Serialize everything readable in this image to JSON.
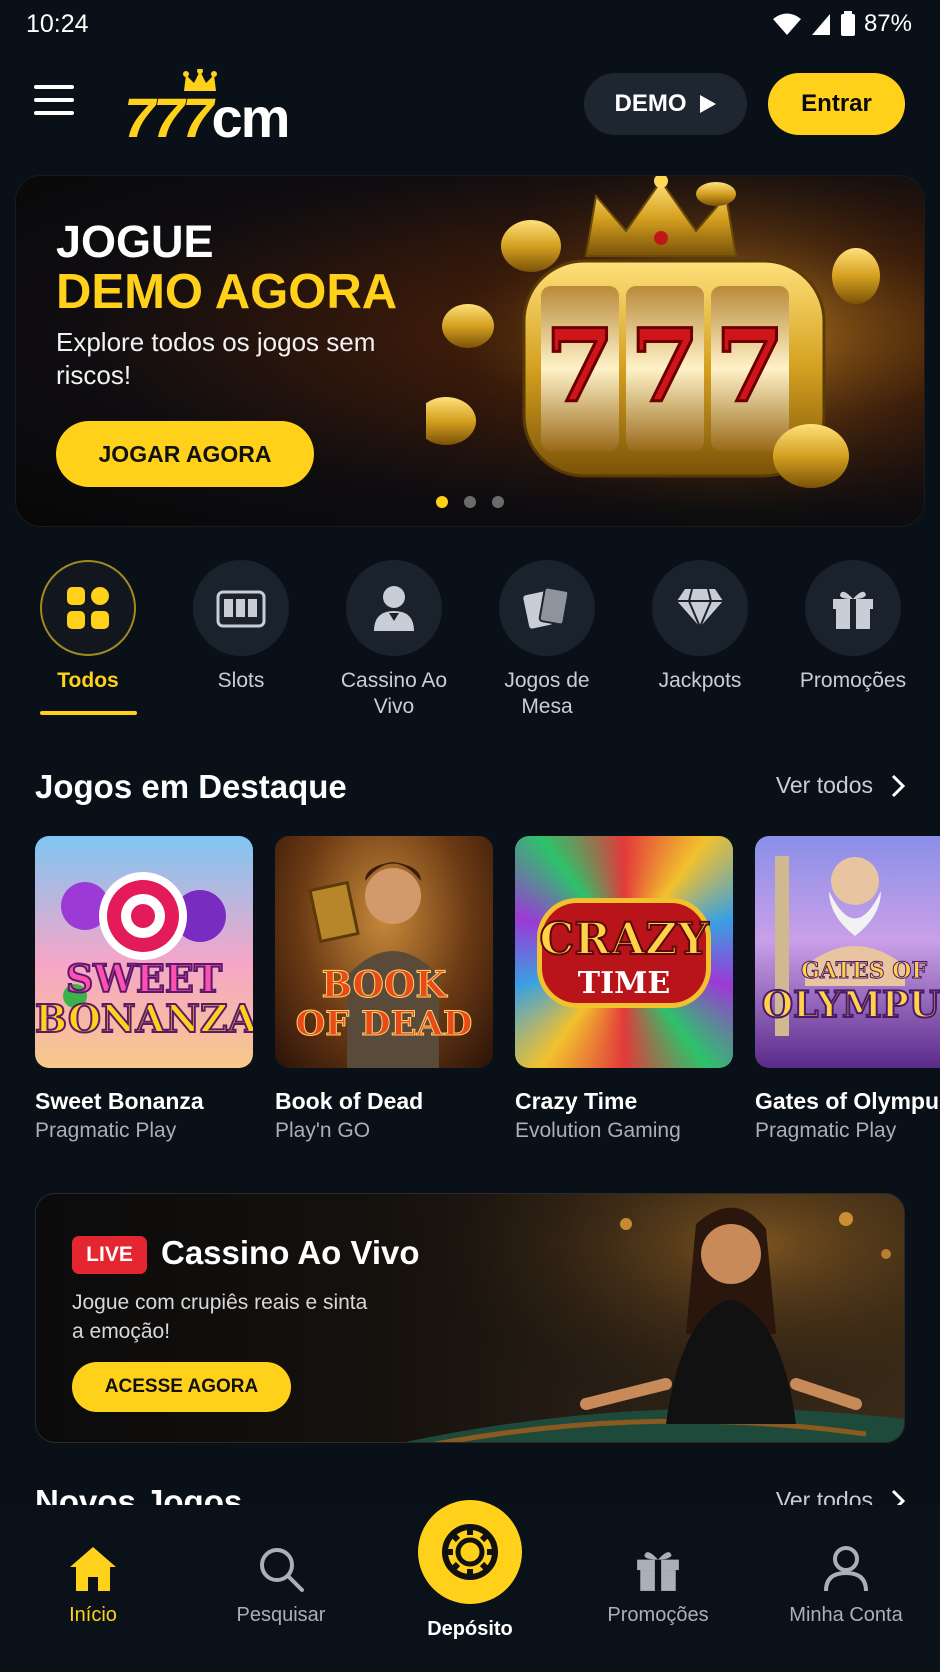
{
  "status": {
    "time": "10:24",
    "battery": "87%"
  },
  "header": {
    "logo_number": "777",
    "logo_suffix": "cm",
    "demo_label": "DEMO",
    "login_label": "Entrar"
  },
  "hero": {
    "title_line1": "JOGUE",
    "title_line2": "DEMO AGORA",
    "subtitle": "Explore todos os jogos sem riscos!",
    "cta": "JOGAR AGORA",
    "slot_digits": "777",
    "slides": 3,
    "active_slide": 1
  },
  "categories": [
    {
      "label": "Todos",
      "icon": "grid-icon",
      "active": true
    },
    {
      "label": "Slots",
      "icon": "slot-machine-icon"
    },
    {
      "label": "Cassino Ao Vivo",
      "icon": "dealer-icon"
    },
    {
      "label": "Jogos de Mesa",
      "icon": "cards-icon"
    },
    {
      "label": "Jackpots",
      "icon": "diamond-icon"
    },
    {
      "label": "Promoções",
      "icon": "gift-icon"
    }
  ],
  "featured": {
    "title": "Jogos em Destaque",
    "see_all": "Ver todos",
    "games": [
      {
        "name": "Sweet Bonanza",
        "provider": "Pragmatic Play",
        "art_line1": "SWEET",
        "art_line2": "BONANZA"
      },
      {
        "name": "Book of Dead",
        "provider": "Play'n GO",
        "art_line1": "BOOK",
        "art_line2": "OF DEAD"
      },
      {
        "name": "Crazy Time",
        "provider": "Evolution Gaming",
        "art_line1": "CRAZY",
        "art_line2": "TIME"
      },
      {
        "name": "Gates of Olympus",
        "provider": "Pragmatic Play",
        "art_line1": "GATES OF",
        "art_line2": "OLYMPUS"
      }
    ]
  },
  "live_casino": {
    "badge": "LIVE",
    "title": "Cassino Ao Vivo",
    "subtitle": "Jogue com crupiês reais e sinta a emoção!",
    "cta": "ACESSE AGORA"
  },
  "new_games": {
    "title": "Novos Jogos",
    "see_all": "Ver todos"
  },
  "bottom_nav": [
    {
      "label": "Início",
      "icon": "home-icon",
      "active": true
    },
    {
      "label": "Pesquisar",
      "icon": "search-icon"
    },
    {
      "label": "Depósito",
      "icon": "chip-icon"
    },
    {
      "label": "Promoções",
      "icon": "gift-icon"
    },
    {
      "label": "Minha Conta",
      "icon": "user-icon"
    }
  ],
  "colors": {
    "accent": "#ffd11a",
    "background": "#0a1018",
    "live_red": "#e3262f"
  }
}
